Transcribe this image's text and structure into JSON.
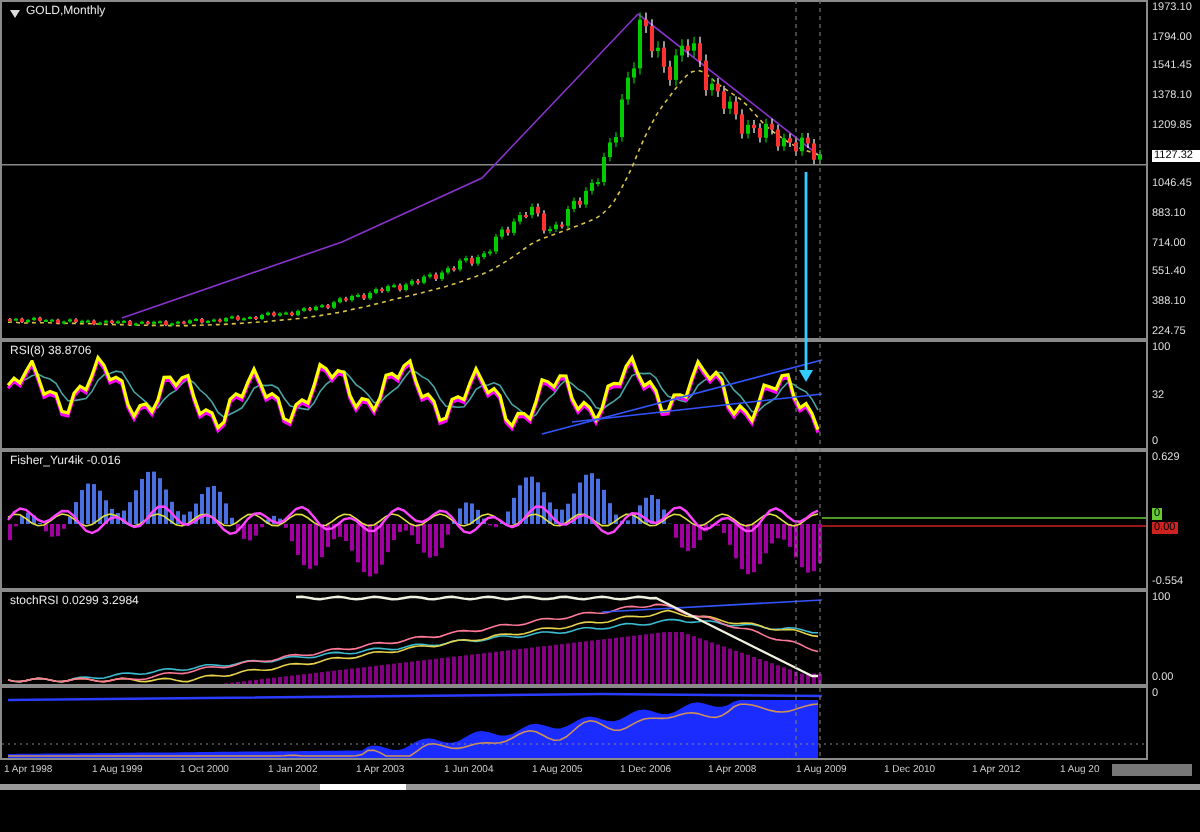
{
  "main_chart": {
    "title": "GOLD,Monthly",
    "price_labels": [
      {
        "text": "1973.10",
        "kind": "tick"
      },
      {
        "text": "1794.00",
        "kind": "tick"
      },
      {
        "text": "1541.45",
        "kind": "tick"
      },
      {
        "text": "1378.10",
        "kind": "tick"
      },
      {
        "text": "1209.85",
        "kind": "tick"
      },
      {
        "text": "1127.32",
        "kind": "current"
      },
      {
        "text": "1046.45",
        "kind": "tick"
      },
      {
        "text": "883.10",
        "kind": "tick"
      },
      {
        "text": "714.00",
        "kind": "tick"
      },
      {
        "text": "551.40",
        "kind": "tick"
      },
      {
        "text": "388.10",
        "kind": "tick"
      },
      {
        "text": "224.75",
        "kind": "tick"
      }
    ]
  },
  "indicators": [
    {
      "kind": "rsi",
      "title": "RSI(8) 38.8706",
      "scale_labels": [
        {
          "text": "100",
          "kind": "tick"
        },
        {
          "text": "32",
          "kind": "tick"
        },
        {
          "text": "0",
          "kind": "tick"
        }
      ]
    },
    {
      "kind": "fisher",
      "title": "Fisher_Yur4ik -0.016",
      "scale_labels": [
        {
          "text": "0.629",
          "kind": "tick"
        },
        {
          "text": "0",
          "kind": "marker",
          "color": "#66cc33"
        },
        {
          "text": "0.00",
          "kind": "marker",
          "color": "#cc2222"
        },
        {
          "text": "-0.554",
          "kind": "tick"
        }
      ]
    },
    {
      "kind": "stoch",
      "title": "stochRSI 0.0299 3.2984",
      "scale_labels": [
        {
          "text": "100",
          "kind": "tick"
        },
        {
          "text": "0.00",
          "kind": "tick"
        }
      ]
    },
    {
      "kind": "area",
      "scale_labels": [
        {
          "text": "0",
          "kind": "tick"
        }
      ]
    }
  ],
  "time_axis": {
    "labels": [
      "1 Apr 1998",
      "1 Aug 1999",
      "1 Oct 2000",
      "1 Jan 2002",
      "1 Apr 2003",
      "1 Jun 2004",
      "1 Aug 2005",
      "1 Dec 2006",
      "1 Apr 2008",
      "1 Aug 2009",
      "1 Dec 2010",
      "1 Apr 2012",
      "1 Aug 20"
    ]
  }
}
